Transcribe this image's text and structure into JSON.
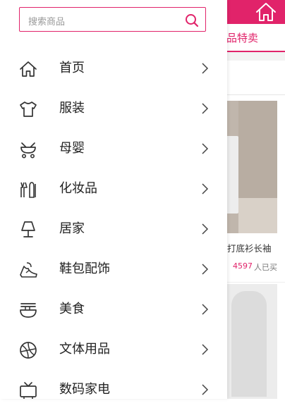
{
  "search": {
    "placeholder": "搜索商品"
  },
  "menu": {
    "items": [
      {
        "label": "首页",
        "icon": "home-icon"
      },
      {
        "label": "服装",
        "icon": "shirt-icon"
      },
      {
        "label": "母婴",
        "icon": "stroller-icon"
      },
      {
        "label": "化妆品",
        "icon": "cosmetics-icon"
      },
      {
        "label": "居家",
        "icon": "lamp-icon"
      },
      {
        "label": "鞋包配饰",
        "icon": "shoe-icon"
      },
      {
        "label": "美食",
        "icon": "noodle-bowl-icon"
      },
      {
        "label": "文体用品",
        "icon": "ball-icon"
      },
      {
        "label": "数码家电",
        "icon": "tv-icon"
      }
    ]
  },
  "background": {
    "tab_label": "品特卖",
    "product": {
      "title": "打底衫长袖",
      "price": "4597",
      "sold": "人已买"
    }
  },
  "colors": {
    "accent": "#e1236a",
    "text": "#222222",
    "icon": "#333333"
  }
}
